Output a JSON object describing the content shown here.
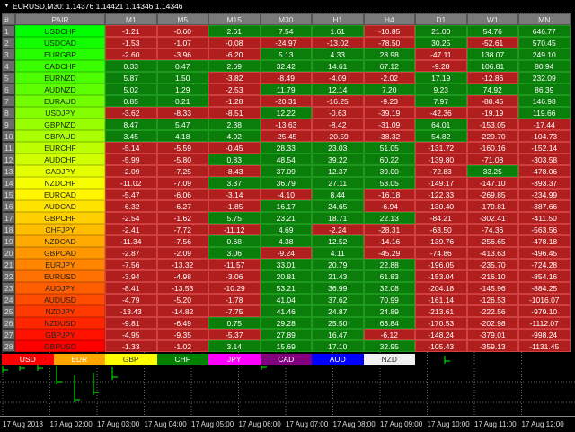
{
  "title": "EURUSD,M30: 1.14376 1.14421 1.14346 1.14346",
  "headers": [
    "#",
    "PAIR",
    "M1",
    "M5",
    "M15",
    "M30",
    "H1",
    "H4",
    "D1",
    "W1",
    "MN"
  ],
  "rows": [
    {
      "n": "1",
      "pair": "USDCHF",
      "v": [
        "-1.21",
        "-0.60",
        "2.61",
        "7.54",
        "1.61",
        "-10.85",
        "21.00",
        "54.76",
        "646.77"
      ]
    },
    {
      "n": "2",
      "pair": "USDCAD",
      "v": [
        "-1.53",
        "-1.07",
        "-0.08",
        "-24.97",
        "-13.02",
        "-78.50",
        "30.25",
        "-52.61",
        "570.45"
      ]
    },
    {
      "n": "3",
      "pair": "EURGBP",
      "v": [
        "-2.60",
        "-3.96",
        "-6.20",
        "5.13",
        "4.33",
        "28.98",
        "-47.11",
        "138.07",
        "249.10"
      ]
    },
    {
      "n": "4",
      "pair": "CADCHF",
      "v": [
        "0.33",
        "0.47",
        "2.69",
        "32.42",
        "14.61",
        "67.12",
        "-9.28",
        "106.81",
        "80.94"
      ]
    },
    {
      "n": "5",
      "pair": "EURNZD",
      "v": [
        "5.87",
        "1.50",
        "-3.82",
        "-8.49",
        "-4.09",
        "-2.02",
        "17.19",
        "-12.86",
        "232.09"
      ]
    },
    {
      "n": "6",
      "pair": "AUDNZD",
      "v": [
        "5.02",
        "1.29",
        "-2.53",
        "11.79",
        "12.14",
        "7.20",
        "9.23",
        "74.92",
        "86.39"
      ]
    },
    {
      "n": "7",
      "pair": "EURAUD",
      "v": [
        "0.85",
        "0.21",
        "-1.28",
        "-20.31",
        "-16.25",
        "-9.23",
        "7.97",
        "-88.45",
        "146.98"
      ]
    },
    {
      "n": "8",
      "pair": "USDJPY",
      "v": [
        "-3.62",
        "-8.33",
        "-8.51",
        "12.22",
        "-0.63",
        "-39.19",
        "-42.36",
        "-19.19",
        "119.66"
      ]
    },
    {
      "n": "9",
      "pair": "GBPNZD",
      "v": [
        "8.47",
        "5.47",
        "2.38",
        "-13.63",
        "-8.42",
        "-31.09",
        "64.01",
        "-153.05",
        "-17.44"
      ]
    },
    {
      "n": "10",
      "pair": "GBPAUD",
      "v": [
        "3.45",
        "4.18",
        "4.92",
        "-25.45",
        "-20.59",
        "-38.32",
        "54.82",
        "-229.70",
        "-104.73"
      ]
    },
    {
      "n": "11",
      "pair": "EURCHF",
      "v": [
        "-5.14",
        "-5.59",
        "-0.45",
        "28.33",
        "23.03",
        "51.05",
        "-131.72",
        "-160.16",
        "-152.14"
      ]
    },
    {
      "n": "12",
      "pair": "AUDCHF",
      "v": [
        "-5.99",
        "-5.80",
        "0.83",
        "48.54",
        "39.22",
        "60.22",
        "-139.80",
        "-71.08",
        "-303.58"
      ]
    },
    {
      "n": "13",
      "pair": "CADJPY",
      "v": [
        "-2.09",
        "-7.25",
        "-8.43",
        "37.09",
        "12.37",
        "39.00",
        "-72.83",
        "33.25",
        "-478.06"
      ]
    },
    {
      "n": "14",
      "pair": "NZDCHF",
      "v": [
        "-11.02",
        "-7.09",
        "3.37",
        "36.79",
        "27.11",
        "53.05",
        "-149.17",
        "-147.10",
        "-393.37"
      ]
    },
    {
      "n": "15",
      "pair": "EURCAD",
      "v": [
        "-5.47",
        "-6.06",
        "-3.14",
        "-4.10",
        "8.44",
        "-16.18",
        "-122.33",
        "-269.85",
        "-234.99"
      ]
    },
    {
      "n": "16",
      "pair": "AUDCAD",
      "v": [
        "-6.32",
        "-6.27",
        "-1.85",
        "16.17",
        "24.65",
        "-6.94",
        "-130.40",
        "-179.81",
        "-387.66"
      ]
    },
    {
      "n": "17",
      "pair": "GBPCHF",
      "v": [
        "-2.54",
        "-1.62",
        "5.75",
        "23.21",
        "18.71",
        "22.13",
        "-84.21",
        "-302.41",
        "-411.50"
      ]
    },
    {
      "n": "18",
      "pair": "CHFJPY",
      "v": [
        "-2.41",
        "-7.72",
        "-11.12",
        "4.69",
        "-2.24",
        "-28.31",
        "-63.50",
        "-74.36",
        "-563.56"
      ]
    },
    {
      "n": "19",
      "pair": "NZDCAD",
      "v": [
        "-11.34",
        "-7.56",
        "0.68",
        "4.38",
        "12.52",
        "-14.16",
        "-139.76",
        "-256.65",
        "-478.18"
      ]
    },
    {
      "n": "20",
      "pair": "GBPCAD",
      "v": [
        "-2.87",
        "-2.09",
        "3.06",
        "-9.24",
        "4.11",
        "-45.29",
        "-74.86",
        "-413.63",
        "-496.45"
      ]
    },
    {
      "n": "21",
      "pair": "EURJPY",
      "v": [
        "-7.56",
        "-13.32",
        "-11.57",
        "33.01",
        "20.79",
        "22.88",
        "-196.05",
        "-235.70",
        "-724.28"
      ]
    },
    {
      "n": "22",
      "pair": "EURUSD",
      "v": [
        "-3.94",
        "-4.98",
        "-3.06",
        "20.81",
        "21.43",
        "61.83",
        "-153.04",
        "-216.10",
        "-854.16"
      ]
    },
    {
      "n": "23",
      "pair": "AUDJPY",
      "v": [
        "-8.41",
        "-13.53",
        "-10.29",
        "53.21",
        "36.99",
        "32.08",
        "-204.18",
        "-145.96",
        "-884.25"
      ]
    },
    {
      "n": "24",
      "pair": "AUDUSD",
      "v": [
        "-4.79",
        "-5.20",
        "-1.78",
        "41.04",
        "37.62",
        "70.99",
        "-161.14",
        "-126.53",
        "-1016.07"
      ]
    },
    {
      "n": "25",
      "pair": "NZDJPY",
      "v": [
        "-13.43",
        "-14.82",
        "-7.75",
        "41.46",
        "24.87",
        "24.89",
        "-213.61",
        "-222.56",
        "-979.10"
      ]
    },
    {
      "n": "26",
      "pair": "NZDUSD",
      "v": [
        "-9.81",
        "-6.49",
        "0.75",
        "29.28",
        "25.50",
        "63.84",
        "-170.53",
        "-202.98",
        "-1112.07"
      ]
    },
    {
      "n": "27",
      "pair": "GBPJPY",
      "v": [
        "-4.95",
        "-9.35",
        "-5.37",
        "27.89",
        "16.47",
        "-6.12",
        "-148.24",
        "-379.01",
        "-998.24"
      ]
    },
    {
      "n": "28",
      "pair": "GBPUSD",
      "v": [
        "-1.33",
        "-1.02",
        "3.14",
        "15.69",
        "17.10",
        "32.95",
        "-105.43",
        "-359.13",
        "-1131.45"
      ]
    }
  ],
  "legend": [
    {
      "label": "USD",
      "bg": "#ff0000",
      "fg": "#ffffff"
    },
    {
      "label": "EUR",
      "bg": "#ffa500",
      "fg": "#ffffff"
    },
    {
      "label": "GBP",
      "bg": "#ffff00",
      "fg": "#333333"
    },
    {
      "label": "CHF",
      "bg": "#008000",
      "fg": "#ffffff"
    },
    {
      "label": "JPY",
      "bg": "#ff00ff",
      "fg": "#ffffff"
    },
    {
      "label": "CAD",
      "bg": "#800080",
      "fg": "#ffffff"
    },
    {
      "label": "AUD",
      "bg": "#0000ff",
      "fg": "#ffffff"
    },
    {
      "label": "NZD",
      "bg": "#f0f0f0",
      "fg": "#333333"
    }
  ],
  "xaxis": [
    "17 Aug 2018",
    "17 Aug 02:00",
    "17 Aug 03:00",
    "17 Aug 04:00",
    "17 Aug 05:00",
    "17 Aug 06:00",
    "17 Aug 07:00",
    "17 Aug 08:00",
    "17 Aug 09:00",
    "17 Aug 10:00",
    "17 Aug 11:00",
    "17 Aug 12:00"
  ],
  "colors": {
    "positive": "#0b7d0b",
    "negative": "#b01e1e",
    "bars": "#00ff00"
  }
}
